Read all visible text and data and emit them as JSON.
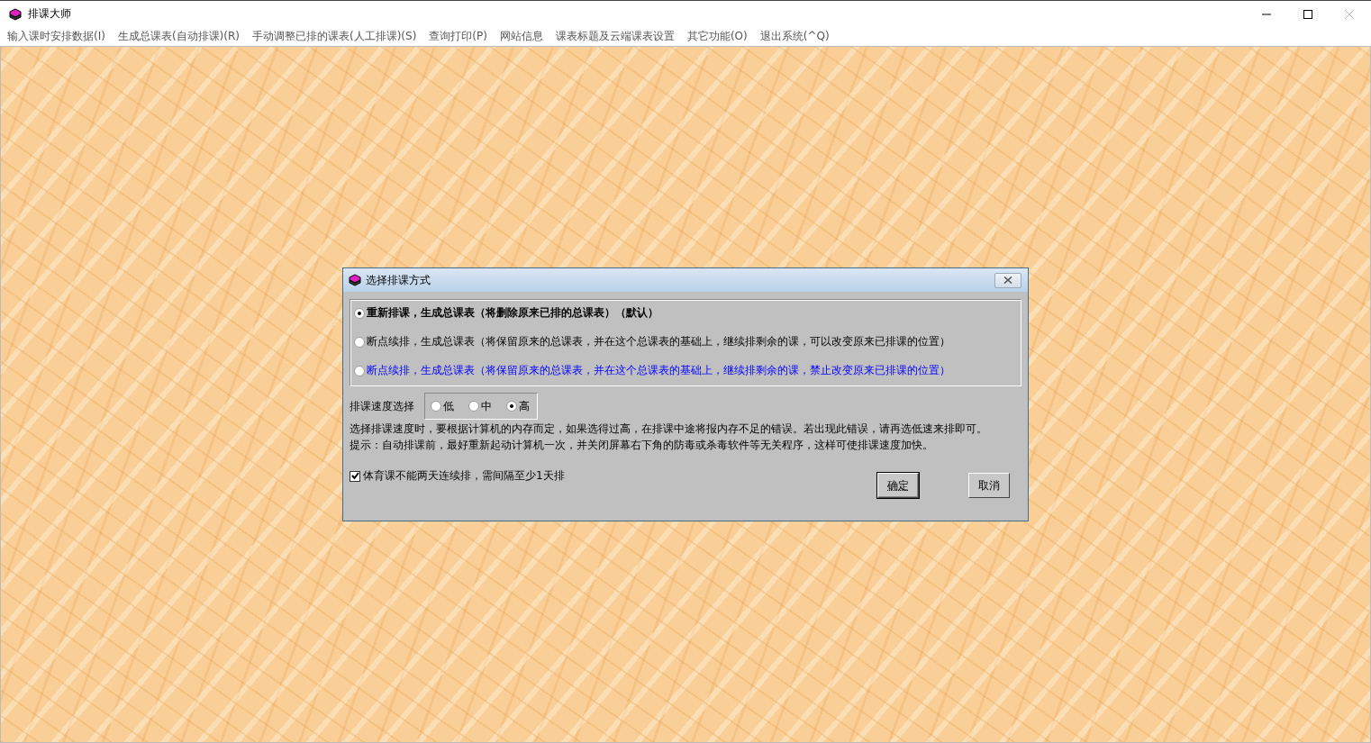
{
  "window": {
    "title": "排课大师"
  },
  "menu": [
    {
      "label": "输入课时安排数据(I)"
    },
    {
      "label": "生成总课表(自动排课)(R)"
    },
    {
      "label": "手动调整已排的课表(人工排课)(S)"
    },
    {
      "label": "查询打印(P)"
    },
    {
      "label": "网站信息"
    },
    {
      "label": "课表标题及云端课表设置"
    },
    {
      "label": "其它功能(O)"
    },
    {
      "label": "退出系统(^Q)"
    }
  ],
  "dialog": {
    "title": "选择排课方式",
    "modes": [
      {
        "label": "重新排课，生成总课表（将删除原来已排的总课表）（默认）",
        "selected": true,
        "bold": true,
        "color": "#000000"
      },
      {
        "label": "断点续排，生成总课表（将保留原来的总课表，并在这个总课表的基础上，继续排剩余的课，可以改变原来已排课的位置）",
        "selected": false,
        "bold": false,
        "color": "#000000"
      },
      {
        "label": "断点续排，生成总课表（将保留原来的总课表，并在这个总课表的基础上，继续排剩余的课，禁止改变原来已排课的位置）",
        "selected": false,
        "bold": false,
        "color": "#0000ff"
      }
    ],
    "speed_label": "排课速度选择",
    "speeds": [
      {
        "label": "低",
        "selected": false
      },
      {
        "label": "中",
        "selected": false
      },
      {
        "label": "高",
        "selected": true
      }
    ],
    "notes": [
      "选择排课速度时，要根据计算机的内存而定，如果选得过高，在排课中途将报内存不足的错误。若出现此错误，请再选低速来排即可。",
      "提示：自动排课前，最好重新起动计算机一次，并关闭屏幕右下角的防毒或杀毒软件等无关程序，这样可使排课速度加快。"
    ],
    "pe_option": {
      "label": "体育课不能两天连续排，需间隔至少1天排",
      "checked": true
    },
    "buttons": [
      {
        "label": "确定",
        "default": true
      },
      {
        "label": "取消",
        "default": false
      }
    ]
  }
}
